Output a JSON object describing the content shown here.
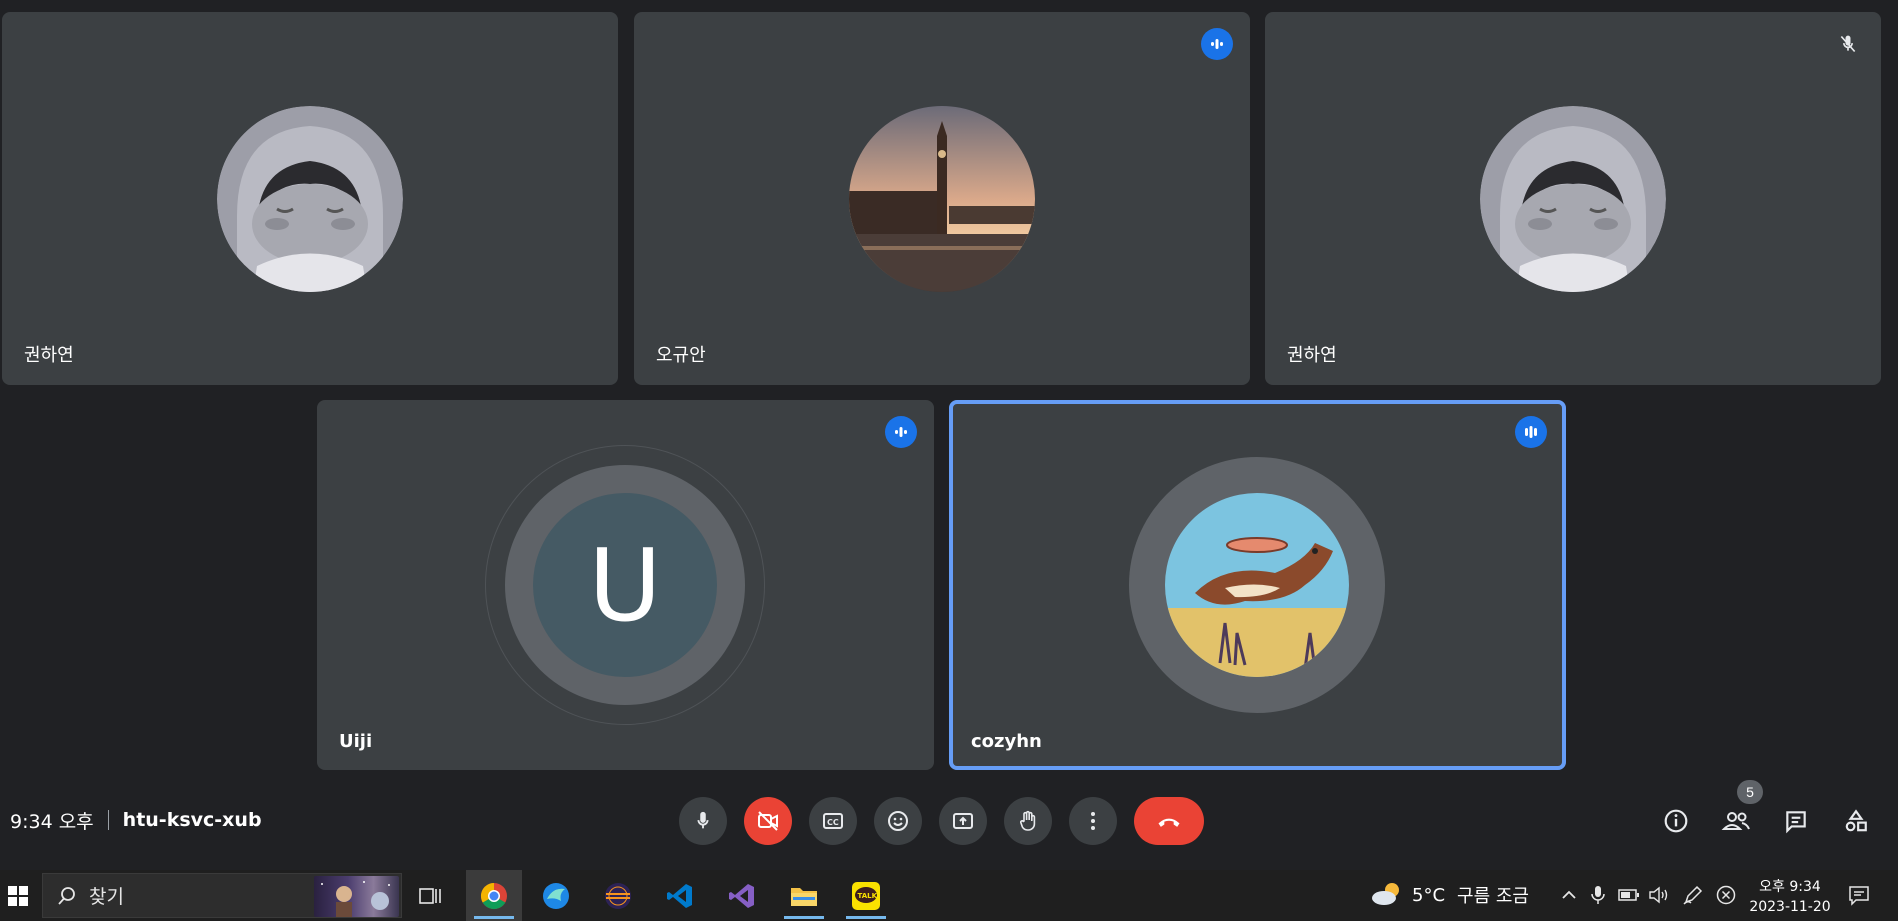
{
  "tiles": [
    {
      "name": "권하연",
      "avatar": "sleeping-character-avatar",
      "status": "none"
    },
    {
      "name": "오규안",
      "avatar": "big-ben-photo-avatar",
      "status": "speaking"
    },
    {
      "name": "권하연",
      "avatar": "sleeping-character-avatar",
      "status": "muted"
    },
    {
      "name": "Uiji",
      "avatar_initial": "U",
      "status": "speaking"
    },
    {
      "name": "cozyhn",
      "avatar": "dog-frisbee-avatar",
      "status": "speaking",
      "active_speaker": true
    }
  ],
  "meeting": {
    "time": "9:34 오후",
    "code": "htu-ksvc-xub"
  },
  "controls": {
    "mic": "microphone-icon",
    "camera_off": "camera-off-icon",
    "captions": "captions-icon",
    "emoji": "emoji-icon",
    "present": "present-screen-icon",
    "raise_hand": "raise-hand-icon",
    "more": "more-options-icon",
    "leave": "hang-up-icon"
  },
  "side_controls": {
    "people_count": "5"
  },
  "taskbar": {
    "search_placeholder": "찾기",
    "weather_temp": "5°C",
    "weather_desc": "구름 조금",
    "clock_time": "오후 9:34",
    "clock_date": "2023-11-20"
  },
  "colors": {
    "background": "#202124",
    "tile": "#3c4043",
    "speaking_badge": "#1a73e8",
    "active_outline": "#669df6",
    "danger": "#ea4335"
  }
}
